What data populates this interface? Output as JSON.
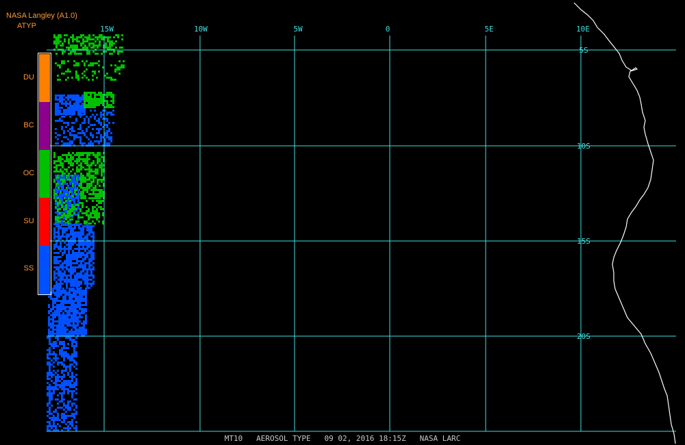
{
  "header": {
    "source": "NASA Langley (A1.0)",
    "product": "ATYP"
  },
  "legend": {
    "items": [
      {
        "code": "DU",
        "color": "#ff8000"
      },
      {
        "code": "BC",
        "color": "#8c008c"
      },
      {
        "code": "OC",
        "color": "#00c000"
      },
      {
        "code": "SU",
        "color": "#ff0000"
      },
      {
        "code": "SS",
        "color": "#0050ff"
      }
    ]
  },
  "map": {
    "longitude_labels": [
      "15W",
      "10W",
      "5W",
      "0",
      "5E",
      "10E"
    ],
    "latitude_labels": [
      "5S",
      "10S",
      "15S",
      "20S"
    ],
    "grid_color": "#40e0e0",
    "coast_color": "#ffffff"
  },
  "footer": {
    "instrument": "MT10",
    "product_name": "AEROSOL TYPE",
    "datetime": "09 02, 2016 18:15Z",
    "agency": "NASA LARC"
  }
}
